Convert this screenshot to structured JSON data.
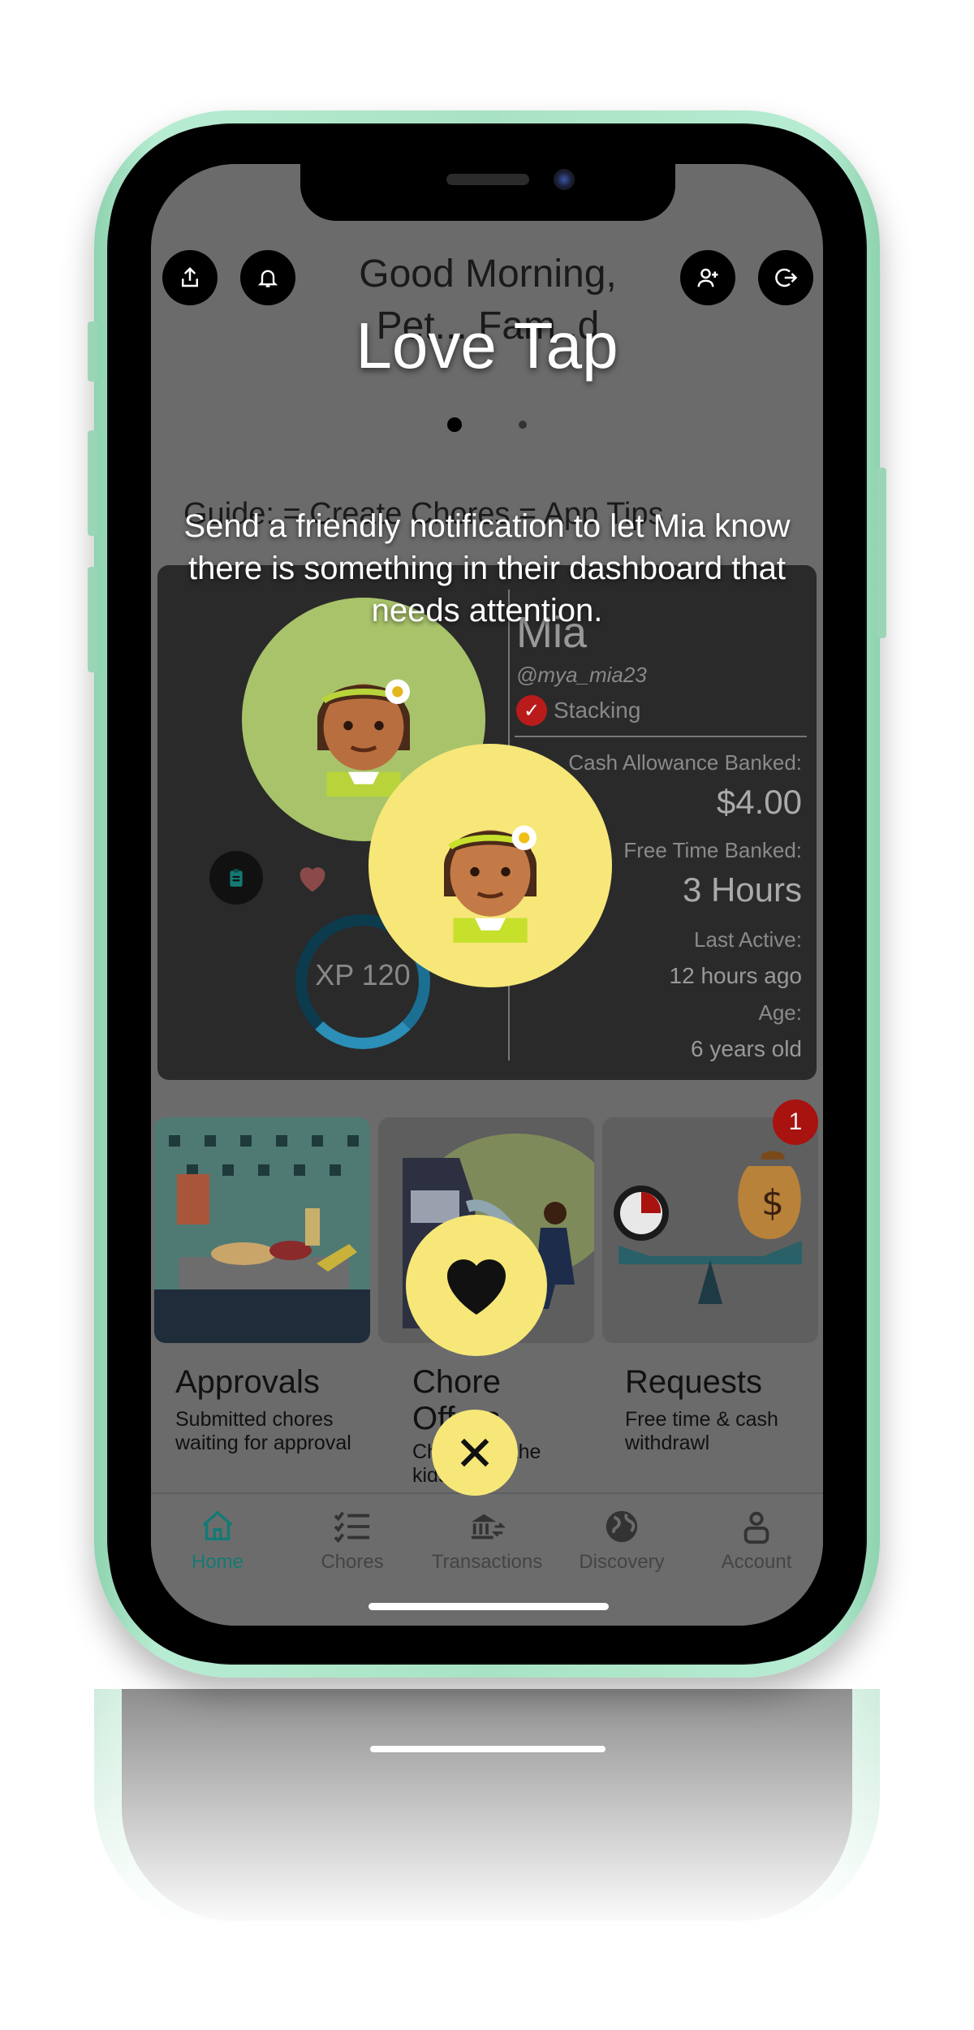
{
  "app": {
    "greeting": "Good Morning, Pet... Fam..d"
  },
  "overlay": {
    "title": "Love Tap",
    "description": "Send a friendly notification to let Mia know there is something in their dashboard that needs attention."
  },
  "guide": {
    "text": "Guide: = Create Chores = App Tips"
  },
  "kid_card": {
    "name": "Mia",
    "handle": "@mya_mia23",
    "status": "Stacking",
    "cash_label": "Cash Allowance Banked:",
    "cash_value": "$4.00",
    "time_label": "Free Time Banked:",
    "time_value": "3 Hours",
    "active_label": "Last Active:",
    "active_value": "12 hours ago",
    "age_label": "Age:",
    "age_value": "6 years old",
    "xp": "XP 120"
  },
  "tiles": [
    {
      "title": "Approvals",
      "subtitle": "Submitted chores waiting for approval"
    },
    {
      "title": "Chore Offers",
      "subtitle": "Chores for the kids"
    },
    {
      "title": "Requests",
      "subtitle": "Free time & cash withdrawl",
      "badge": "1"
    }
  ],
  "tabbar": {
    "items": [
      {
        "label": "Home",
        "icon": "home-icon",
        "active": true
      },
      {
        "label": "Chores",
        "icon": "checklist-icon"
      },
      {
        "label": "Transactions",
        "icon": "bank-transfer-icon"
      },
      {
        "label": "Discovery",
        "icon": "globe-icon"
      },
      {
        "label": "Account",
        "icon": "person-icon"
      }
    ]
  },
  "colors": {
    "accent_yellow": "#f6e778",
    "tab_active": "#147a74",
    "frame_green": "#a8e2c4",
    "badge_red": "#a8120f"
  }
}
